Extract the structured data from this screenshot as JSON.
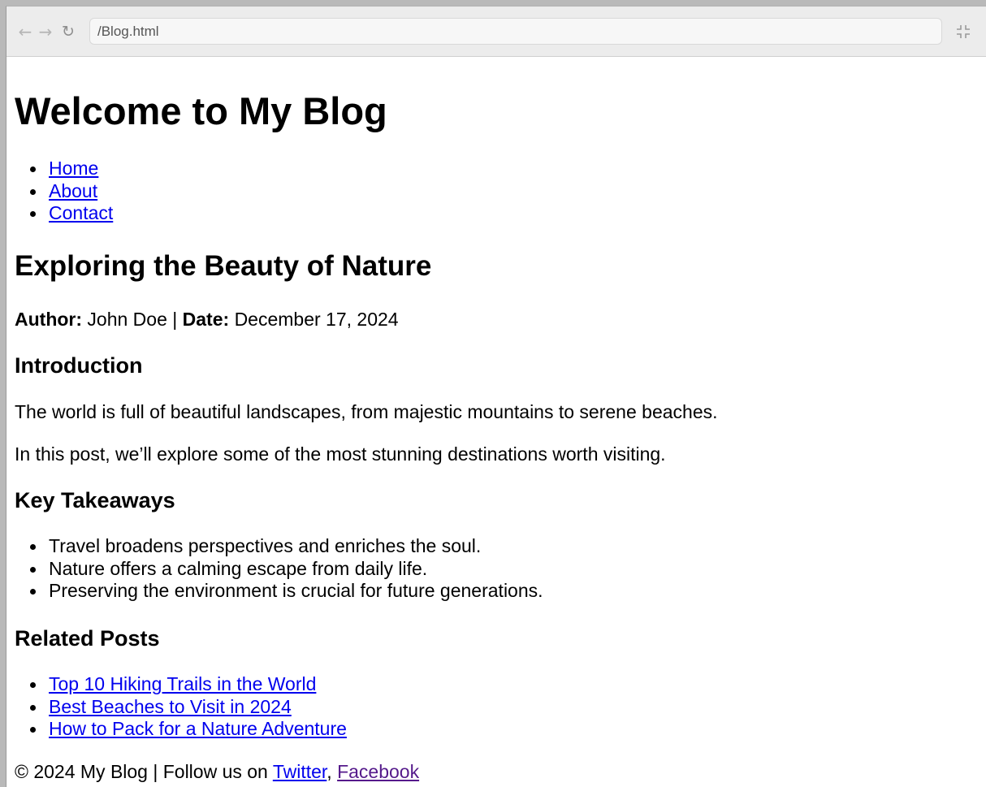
{
  "browser": {
    "address_bar": "/Blog.html",
    "back_icon": "arrow-left-icon",
    "forward_icon": "arrow-right-icon",
    "reload_icon": "reload-icon",
    "collapse_icon": "collapse-icon"
  },
  "page": {
    "title": "Welcome to My Blog",
    "nav": [
      {
        "label": "Home"
      },
      {
        "label": "About"
      },
      {
        "label": "Contact"
      }
    ],
    "post": {
      "title": "Exploring the Beauty of Nature",
      "author_label": "Author:",
      "author": "John Doe",
      "separator": "|",
      "date_label": "Date:",
      "date": "December 17, 2024",
      "intro_heading": "Introduction",
      "paragraphs": [
        "The world is full of beautiful landscapes, from majestic mountains to serene beaches.",
        "In this post, we’ll explore some of the most stunning destinations worth visiting."
      ],
      "takeaways_heading": "Key Takeaways",
      "takeaways": [
        "Travel broadens perspectives and enriches the soul.",
        "Nature offers a calming escape from daily life.",
        "Preserving the environment is crucial for future generations."
      ]
    },
    "related": {
      "heading": "Related Posts",
      "links": [
        {
          "label": "Top 10 Hiking Trails in the World"
        },
        {
          "label": "Best Beaches to Visit in 2024"
        },
        {
          "label": "How to Pack for a Nature Adventure"
        }
      ]
    },
    "footer": {
      "text": "© 2024 My Blog | Follow us on ",
      "twitter": "Twitter",
      "comma": ",",
      "facebook": "Facebook"
    }
  },
  "colors": {
    "link": "#0000ee",
    "visited_link": "#551a8b"
  }
}
